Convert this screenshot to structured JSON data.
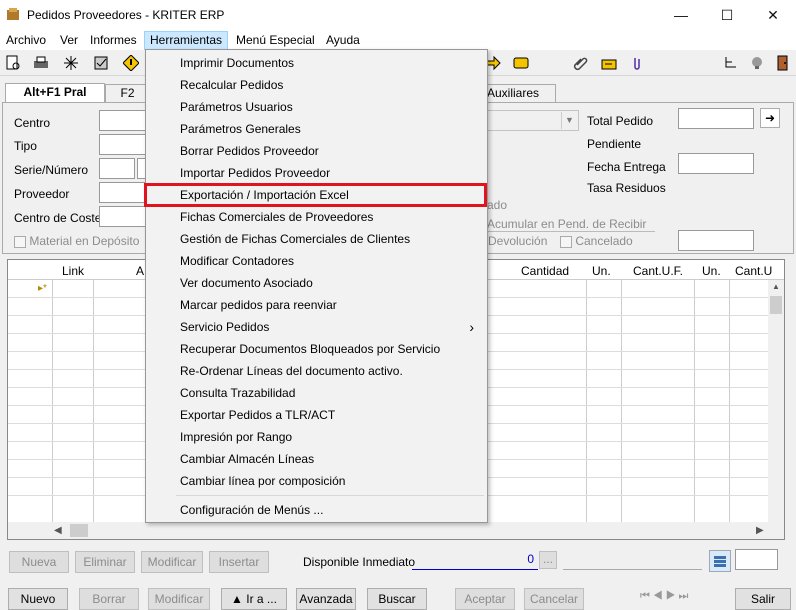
{
  "window": {
    "title": "Pedidos Proveedores - KRITER ERP",
    "minimize": "—",
    "maximize": "☐",
    "close": "✕"
  },
  "menubar": {
    "items": [
      "Archivo",
      "Ver",
      "Informes",
      "Herramientas",
      "Menú Especial",
      "Ayuda"
    ]
  },
  "tabs": [
    "Alt+F1 Pral",
    "F2",
    "Auxiliares"
  ],
  "form": {
    "labels": {
      "centro": "Centro",
      "tipo": "Tipo",
      "serie": "Serie/Número",
      "proveedor": "Proveedor",
      "centro_coste": "Centro de Coste",
      "total_pedido": "Total Pedido",
      "pendiente": "Pendiente",
      "fecha_entrega": "Fecha Entrega",
      "tasa_residuos": "Tasa Residuos"
    },
    "partial_text": "ado",
    "acumular": "Acumular en Pend. de Recibir",
    "material_deposito": "Material en Depósito",
    "devolucion": "Devolución",
    "cancelado": "Cancelado",
    "go_button": "➜"
  },
  "grid": {
    "columns": [
      "Link",
      "A",
      "Cantidad",
      "Un.",
      "Cant.U.F.",
      "Un.",
      "Cant.U"
    ],
    "row_marker": "▸*"
  },
  "grid_buttons": [
    "Nueva",
    "Eliminar",
    "Modificar",
    "Insertar"
  ],
  "disponible": {
    "label": "Disponible Inmediato",
    "value": "0",
    "ellipsis": "..."
  },
  "bottom_buttons": [
    "Nuevo",
    "Borrar",
    "Modificar",
    "▲ Ir a ...",
    "Avanzada",
    "Buscar",
    "Aceptar",
    "Cancelar",
    "Salir"
  ],
  "herramientas_menu": [
    "Imprimir Documentos",
    "Recalcular Pedidos",
    "Parámetros Usuarios",
    "Parámetros Generales",
    "Borrar Pedidos Proveedor",
    "Importar Pedidos Proveedor",
    "Exportación / Importación Excel",
    "Fichas Comerciales de Proveedores",
    "Gestión de Fichas Comerciales de Clientes",
    "Modificar Contadores",
    "Ver documento Asociado",
    "Marcar pedidos para reenviar",
    "Servicio Pedidos",
    "Recuperar Documentos Bloqueados por Servicio",
    "Re-Ordenar Líneas del documento activo.",
    "Consulta Trazabilidad",
    "Exportar Pedidos a TLR/ACT",
    "Impresión por Rango",
    "Cambiar Almacén Líneas",
    "Cambiar línea por composición",
    "Configuración de Menús ..."
  ],
  "submenu_arrow": "›",
  "colors": {
    "highlight": "#e0141e",
    "menu_active_bg": "#cce8ff"
  }
}
